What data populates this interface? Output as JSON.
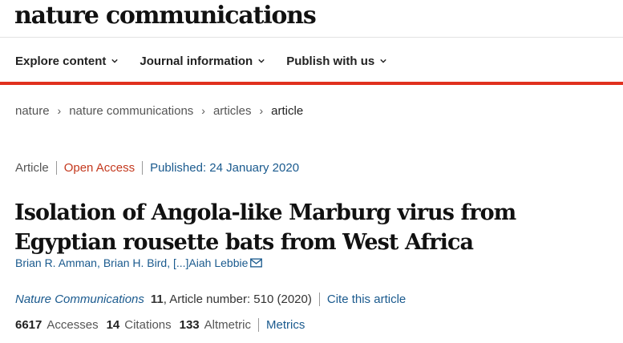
{
  "brand": "nature communications",
  "nav": [
    {
      "label": "Explore content"
    },
    {
      "label": "Journal information"
    },
    {
      "label": "Publish with us"
    }
  ],
  "breadcrumbs": [
    "nature",
    "nature communications",
    "articles",
    "article"
  ],
  "meta": {
    "type": "Article",
    "access": "Open Access",
    "published": "Published: 24 January 2020"
  },
  "title": "Isolation of Angola-like Marburg virus from Egyptian rousette bats from West Africa",
  "authors": {
    "a1": "Brian R. Amman",
    "comma": ",",
    "a2": "Brian H. Bird",
    "sep": ", ",
    "ellipsis": "[...]",
    "a3": "Aiah Lebbie"
  },
  "citation": {
    "journal": "Nature Communications",
    "volume": "11",
    "article": ", Article number: 510 (2020)",
    "cite_label": "Cite this article"
  },
  "stats": {
    "accesses_value": "6617",
    "accesses_label": "Accesses",
    "citations_value": "14",
    "citations_label": "Citations",
    "altmetric_value": "133",
    "altmetric_label": "Altmetric",
    "metrics_label": "Metrics"
  },
  "colors": {
    "accent_red": "#e0301e",
    "link_blue": "#1a5a8e",
    "open_access": "#c4391e"
  }
}
